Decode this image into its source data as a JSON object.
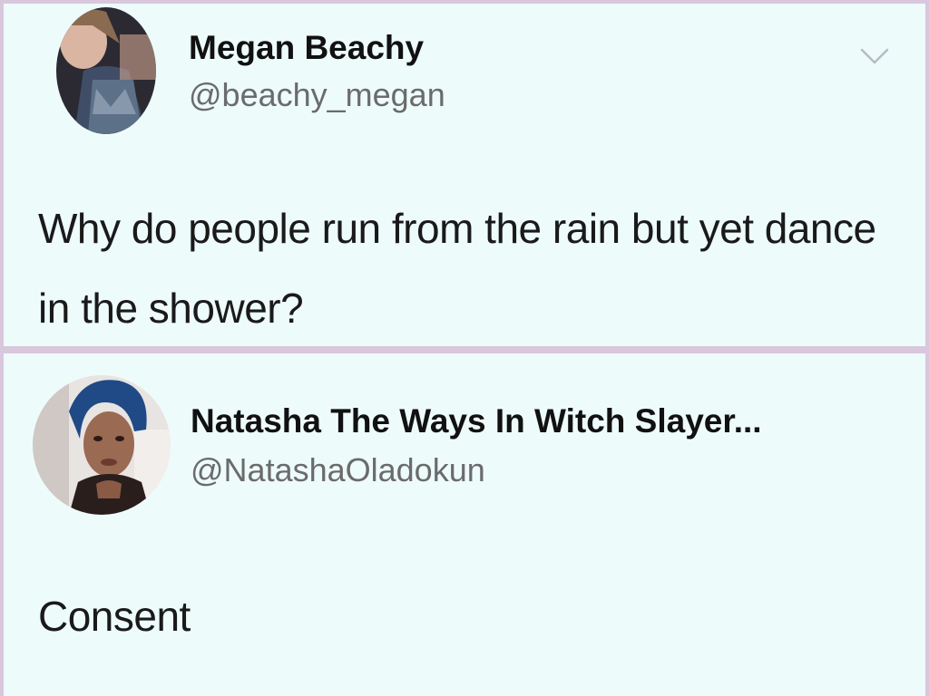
{
  "tweets": [
    {
      "name": "Megan Beachy",
      "handle": "@beachy_megan",
      "text": "Why do people run from the rain but yet dance in the shower?",
      "avatar_icon": "profile-photo",
      "menu_icon": "chevron-down-icon"
    },
    {
      "name": "Natasha The Ways In Witch Slayer...",
      "handle": "@NatashaOladokun",
      "text": "Consent",
      "avatar_icon": "profile-photo"
    }
  ],
  "colors": {
    "card_background": "#eefbfb",
    "divider": "#d9c7dc",
    "name_text": "#111111",
    "handle_text": "#6b6b6b",
    "body_text": "#1a1a1a"
  }
}
